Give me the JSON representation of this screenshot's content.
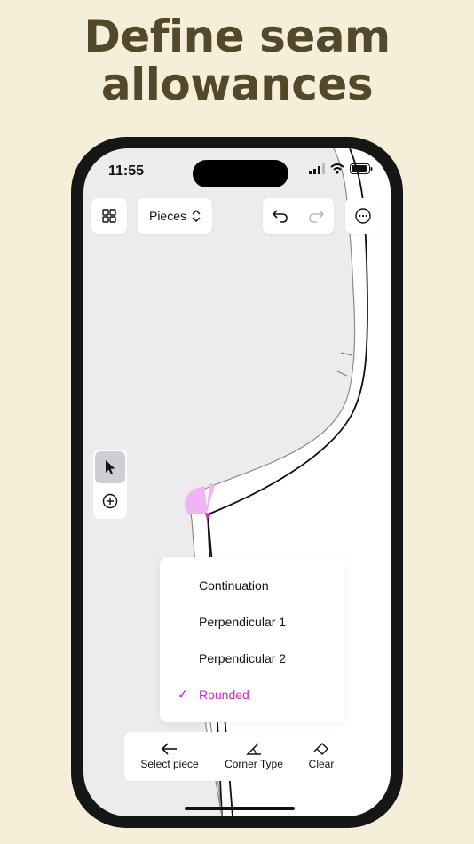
{
  "headline": {
    "line1": "Define seam",
    "line2": "allowances"
  },
  "status_bar": {
    "time": "11:55"
  },
  "toolbar": {
    "pieces_label": "Pieces"
  },
  "corner_menu": {
    "items": [
      {
        "label": "Continuation",
        "selected": false
      },
      {
        "label": "Perpendicular 1",
        "selected": false
      },
      {
        "label": "Perpendicular 2",
        "selected": false
      },
      {
        "label": "Rounded",
        "selected": true
      }
    ],
    "check_glyph": "✓"
  },
  "bottom_bar": {
    "select_piece": "Select piece",
    "corner_type": "Corner Type",
    "clear": "Clear"
  },
  "colors": {
    "background": "#f5efd9",
    "headline": "#54482b",
    "accent": "#cc29c4",
    "corner_highlight": "#f2b3f2"
  },
  "icons": {
    "grid": "grid-icon",
    "chevron": "chevron-updown-icon",
    "undo": "undo-icon",
    "redo": "redo-icon",
    "more": "more-icon",
    "pointer": "pointer-icon",
    "add": "add-point-icon",
    "arrow_left": "arrow-left-icon",
    "corner": "corner-angle-icon",
    "eraser": "eraser-icon"
  }
}
